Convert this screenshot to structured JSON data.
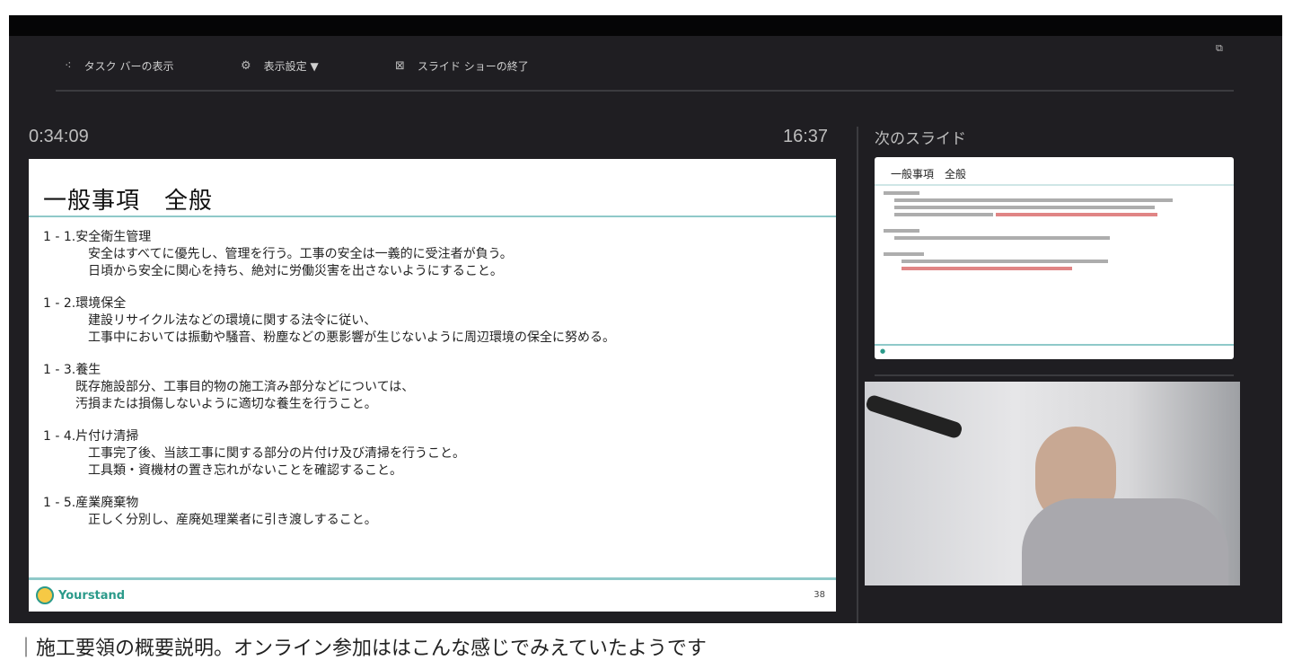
{
  "toolbar": {
    "taskbar": "タスク バーの表示",
    "display_settings": "表示設定 ▼",
    "end_show": "スライド ショーの終了"
  },
  "elapsed_time": "0:34:09",
  "clock": "16:37",
  "slide": {
    "title": "一般事項　全般",
    "items": [
      {
        "heading": "1 - 1.安全衛生管理",
        "lines": [
          "安全はすべてに優先し、管理を行う。工事の安全は一義的に受注者が負う。",
          "日頃から安全に関心を持ち、絶対に労働災害を出さないようにすること。"
        ]
      },
      {
        "heading": "1 - 2.環境保全",
        "lines": [
          "建設リサイクル法などの環境に関する法令に従い、",
          "工事中においては振動や騒音、粉塵などの悪影響が生じないように周辺環境の保全に努める。"
        ]
      },
      {
        "heading": "1 - 3.養生",
        "lines": [
          "既存施設部分、工事目的物の施工済み部分などについては、",
          "汚損または損傷しないように適切な養生を行うこと。"
        ]
      },
      {
        "heading": "1 - 4.片付け清掃",
        "lines": [
          "工事完了後、当該工事に関する部分の片付け及び清掃を行うこと。",
          "工具類・資機材の置き忘れがないことを確認すること。"
        ]
      },
      {
        "heading": "1 - 5.産業廃棄物",
        "lines": [
          "正しく分別し、産廃処理業者に引き渡しすること。"
        ]
      }
    ],
    "logo": "Yourstand",
    "page": "38"
  },
  "next_slide": {
    "label": "次のスライド",
    "title": "一般事項　全般"
  },
  "caption": "｜施工要領の概要説明。オンライン参加ははこんな感じでみえていたようです"
}
